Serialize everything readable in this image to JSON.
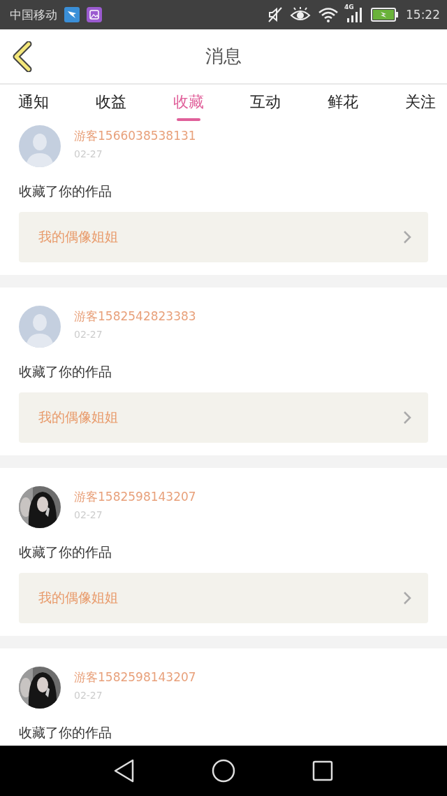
{
  "status_bar": {
    "carrier": "中国移动",
    "network": "4G",
    "time": "15:22"
  },
  "header": {
    "title": "消息"
  },
  "tabs": [
    {
      "label": "通知",
      "selected": false
    },
    {
      "label": "收益",
      "selected": false
    },
    {
      "label": "收藏",
      "selected": true
    },
    {
      "label": "互动",
      "selected": false
    },
    {
      "label": "鲜花",
      "selected": false
    },
    {
      "label": "关注",
      "selected": false
    }
  ],
  "messages": [
    {
      "user": "游客1566038538131",
      "date": "02-27",
      "avatar": {
        "kind": "default"
      },
      "text": "收藏了你的作品",
      "work": "我的偶像姐姐"
    },
    {
      "user": "游客1582542823383",
      "date": "02-27",
      "avatar": {
        "kind": "default"
      },
      "text": "收藏了你的作品",
      "work": "我的偶像姐姐"
    },
    {
      "user": "游客1582598143207",
      "date": "02-27",
      "text": "收藏了你的作品",
      "work": "我的偶像姐姐"
    },
    {
      "user": "游客1582598143207",
      "date": "02-27",
      "text": "收藏了你的作品"
    }
  ]
}
